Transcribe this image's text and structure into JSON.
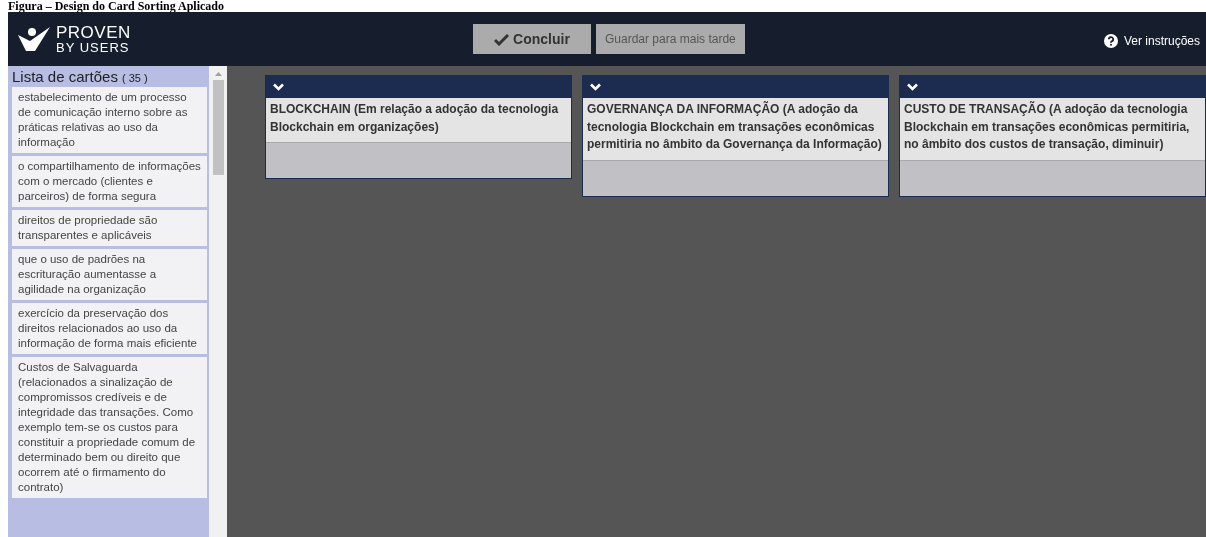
{
  "caption": "Figura – Design do Card Sorting Aplicado",
  "header": {
    "logo": {
      "line_1": "PROVEN",
      "line_2": "BY USERS"
    },
    "buttons": [
      {
        "label": "Concluir",
        "kind": "primary"
      },
      {
        "label": "Guardar para mais tarde",
        "kind": "secondary"
      }
    ],
    "help": "Ver instruções"
  },
  "sidebar": {
    "title": "Lista de cartões",
    "count": "( 35 )",
    "cards": [
      "estabelecimento de um processo de comunicação interno sobre as práticas relativas ao uso da informação",
      "o compartilhamento de informações com o mercado (clientes e parceiros) de forma segura",
      "direitos de propriedade são transparentes e aplicáveis",
      "que o uso de padrões na escrituração aumentasse a agilidade na organização",
      "exercício da preservação dos direitos relacionados ao uso da informação de forma mais eficiente",
      "Custos de Salvaguarda (relacionados a sinalização de compromissos credíveis e de integridade das transações. Como exemplo tem-se os custos para constituir a propriedade comum de determinado bem ou direito que ocorrem até o firmamento do contrato)"
    ]
  },
  "categories": [
    {
      "title": "BLOCKCHAIN (Em relação a adoção da tecnologia Blockchain em organizações)"
    },
    {
      "title": "GOVERNANÇA DA INFORMAÇÃO (A adoção da tecnologia Blockchain em transações econômicas permitiria no âmbito da Governança da Informação)"
    },
    {
      "title": "CUSTO DE TRANSAÇÃO (A adoção da tecnologia Blockchain em transações econômicas permitiria, no âmbito dos custos de transação, diminuir)"
    }
  ]
}
